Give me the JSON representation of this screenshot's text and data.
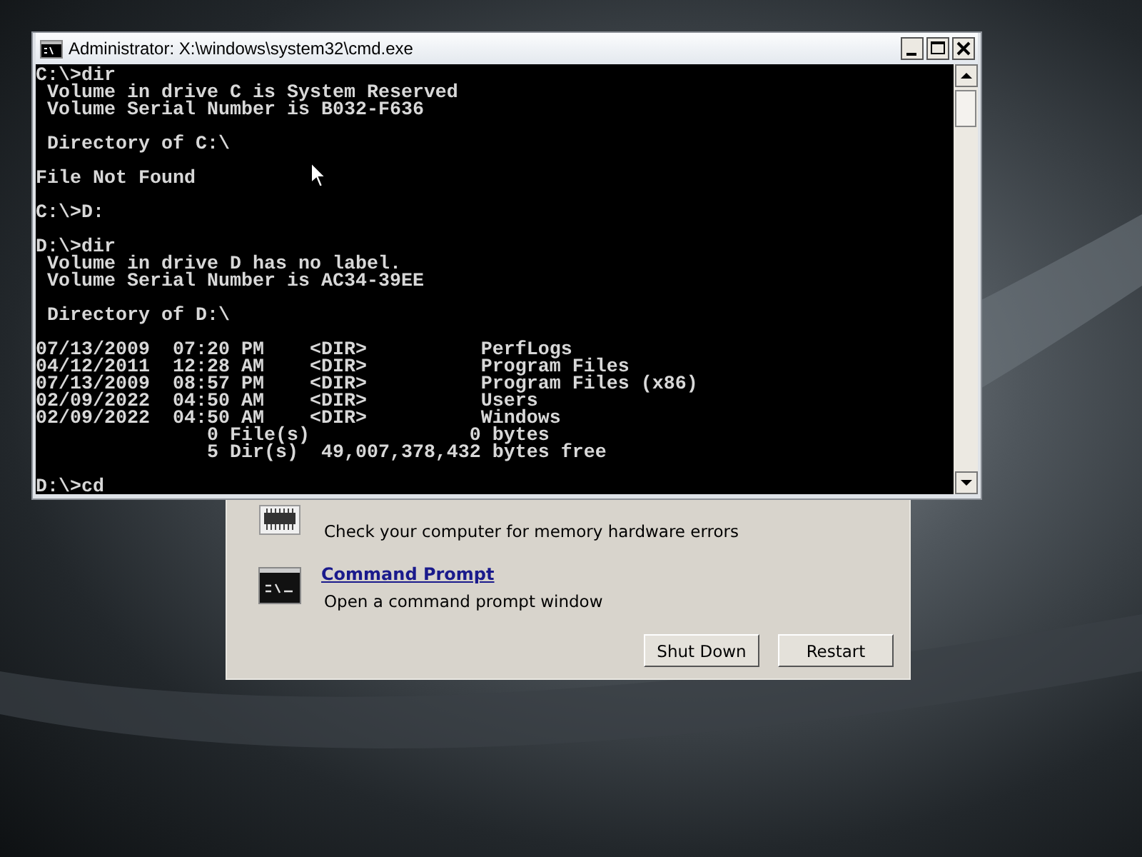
{
  "console_window": {
    "title": "Administrator: X:\\windows\\system32\\cmd.exe",
    "blocks": [
      [
        "C:\\>dir",
        " Volume in drive C is System Reserved",
        " Volume Serial Number is B032-F636"
      ],
      [
        " Directory of C:\\"
      ],
      [
        "File Not Found"
      ],
      [
        "C:\\>D:"
      ],
      [
        "D:\\>dir",
        " Volume in drive D has no label.",
        " Volume Serial Number is AC34-39EE"
      ],
      [
        " Directory of D:\\"
      ],
      [
        "07/13/2009  07:20 PM    <DIR>          PerfLogs",
        "04/12/2011  12:28 AM    <DIR>          Program Files",
        "07/13/2009  08:57 PM    <DIR>          Program Files (x86)",
        "02/09/2022  04:50 AM    <DIR>          Users",
        "02/09/2022  04:50 AM    <DIR>          Windows",
        "               0 File(s)              0 bytes",
        "               5 Dir(s)  49,007,378,432 bytes free"
      ],
      [
        "D:\\>cd"
      ]
    ]
  },
  "recovery_dialog": {
    "items": [
      {
        "kind": "memory",
        "description": "Check your computer for memory hardware errors"
      },
      {
        "kind": "prompt",
        "link": "Command Prompt",
        "description": "Open a command prompt window"
      }
    ],
    "buttons": [
      "Shut Down",
      "Restart"
    ]
  }
}
